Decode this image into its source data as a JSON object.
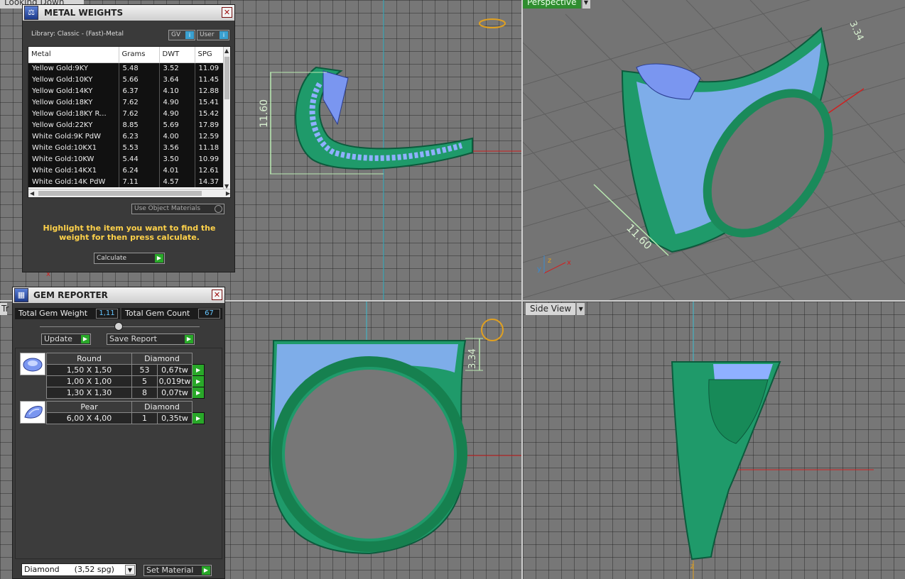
{
  "viewports": {
    "top_label": "Looking Down",
    "persp_label": "Perspective",
    "front_label": "Tr",
    "side_label": "Side View",
    "dim_a": "11.60",
    "dim_b": "3.34",
    "axis_x": "x",
    "axis_y": "y",
    "axis_z": "z"
  },
  "metal_panel": {
    "title": "METAL WEIGHTS",
    "library": "Library: Classic - (Fast)-Metal",
    "gv_label": "GV",
    "user_label": "User",
    "columns": [
      "Metal",
      "Grams",
      "DWT",
      "SPG"
    ],
    "rows": [
      [
        "Yellow Gold:9KY",
        "5.48",
        "3.52",
        "11.09"
      ],
      [
        "Yellow Gold:10KY",
        "5.66",
        "3.64",
        "11.45"
      ],
      [
        "Yellow Gold:14KY",
        "6.37",
        "4.10",
        "12.88"
      ],
      [
        "Yellow Gold:18KY",
        "7.62",
        "4.90",
        "15.41"
      ],
      [
        "Yellow Gold:18KY R...",
        "7.62",
        "4.90",
        "15.42"
      ],
      [
        "Yellow Gold:22KY",
        "8.85",
        "5.69",
        "17.89"
      ],
      [
        "White Gold:9K PdW",
        "6.23",
        "4.00",
        "12.59"
      ],
      [
        "White Gold:10KX1",
        "5.53",
        "3.56",
        "11.18"
      ],
      [
        "White Gold:10KW",
        "5.44",
        "3.50",
        "10.99"
      ],
      [
        "White Gold:14KX1",
        "6.24",
        "4.01",
        "12.61"
      ],
      [
        "White Gold:14K PdW",
        "7.11",
        "4.57",
        "14.37"
      ]
    ],
    "use_object_materials": "Use Object Materials",
    "hint": "Highlight the item you want to find the weight for then press calculate.",
    "calculate_label": "Calculate"
  },
  "gem_panel": {
    "title": "GEM REPORTER",
    "total_weight_label": "Total Gem Weight",
    "total_weight_value": "1,11",
    "total_count_label": "Total Gem Count",
    "total_count_value": "67",
    "update_label": "Update",
    "save_report_label": "Save Report",
    "groups": [
      {
        "shape": "Round",
        "material": "Diamond",
        "rows": [
          [
            "1,50 X 1,50",
            "53",
            "0,67tw"
          ],
          [
            "1,00 X 1,00",
            "5",
            "0,019tw"
          ],
          [
            "1,30 X 1,30",
            "8",
            "0,07tw"
          ]
        ]
      },
      {
        "shape": "Pear",
        "material": "Diamond",
        "rows": [
          [
            "6,00 X 4,00",
            "1",
            "0,35tw"
          ]
        ]
      }
    ],
    "material_select": "Diamond      (3,52 spg)",
    "set_material_label": "Set Material"
  }
}
